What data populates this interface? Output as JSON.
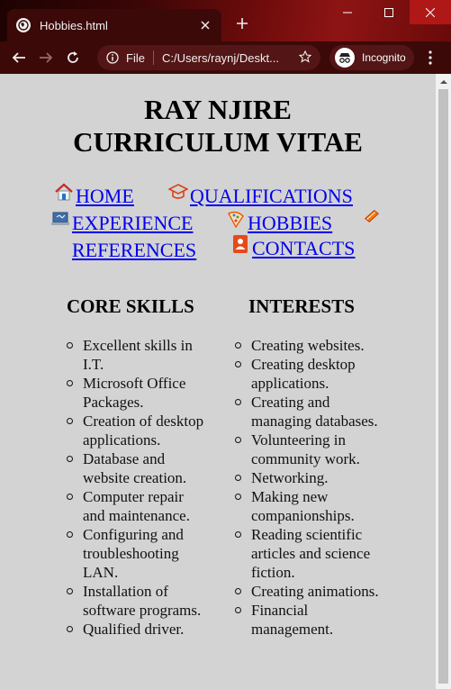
{
  "browser": {
    "tab_title": "Hobbies.html",
    "address_scheme": "File",
    "address_url": "C:/Users/raynj/Deskt...",
    "profile_label": "Incognito",
    "colors": {
      "frame": "#6b0b0b",
      "tab": "#3c0909",
      "close_button": "#b01818"
    }
  },
  "page": {
    "title_line1": "RAY NJIRE",
    "title_line2": "CURRICULUM VITAE",
    "nav": [
      {
        "label": "HOME",
        "icon": "house-icon"
      },
      {
        "label": "QUALIFICATIONS",
        "icon": "mortarboard-icon"
      },
      {
        "label": "EXPERIENCE",
        "icon": "laptop-icon"
      },
      {
        "label": "HOBBIES",
        "icon": "palette-icon"
      },
      {
        "label": "REFERENCES",
        "icon": "book-icon"
      },
      {
        "label": "CONTACTS",
        "icon": "contact-book-icon"
      }
    ],
    "link_color": "#0000ee",
    "core_skills": {
      "heading": "CORE SKILLS",
      "items": [
        [
          "Excellent skills in",
          "I.T."
        ],
        [
          "Microsoft Office",
          "Packages."
        ],
        [
          "Creation of desktop",
          "applications."
        ],
        [
          "Database and",
          "website creation."
        ],
        [
          "Computer repair",
          "and maintenance."
        ],
        [
          "Configuring and",
          "troubleshooting",
          "LAN."
        ],
        [
          "Installation of",
          "software programs."
        ],
        [
          "Qualified driver."
        ]
      ]
    },
    "interests": {
      "heading": "INTERESTS",
      "items": [
        [
          "Creating websites."
        ],
        [
          "Creating desktop",
          "applications."
        ],
        [
          "Creating and",
          "managing databases."
        ],
        [
          "Volunteering in",
          "community work."
        ],
        [
          "Networking."
        ],
        [
          "Making new",
          "companionships."
        ],
        [
          "Reading scientific",
          "articles and science",
          "fiction."
        ],
        [
          "Creating animations."
        ],
        [
          "Financial",
          "management."
        ]
      ]
    }
  }
}
